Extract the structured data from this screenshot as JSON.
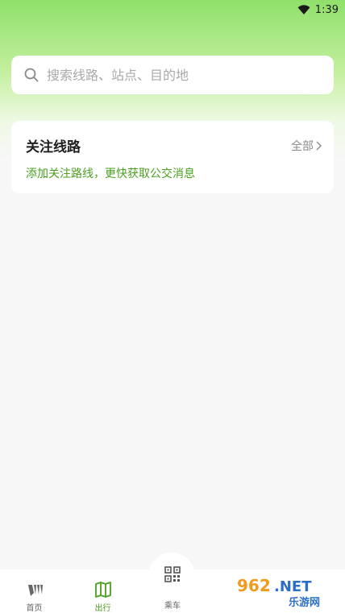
{
  "status": {
    "time": "1:39"
  },
  "search": {
    "placeholder": "搜索线路、站点、目的地"
  },
  "follow": {
    "title": "关注线路",
    "all_label": "全部",
    "desc": "添加关注路线，更快获取公交消息"
  },
  "nav": {
    "items": [
      {
        "label": "首页",
        "icon": "home-icon"
      },
      {
        "label": "出行",
        "icon": "map-icon",
        "active": true
      },
      {
        "label": "乘车",
        "icon": "qr-code-icon"
      }
    ]
  },
  "watermark": {
    "text": "962.NET",
    "subtext": "乐游网"
  },
  "colors": {
    "accent": "#4aa01f",
    "gradient_top": "#8fe06a"
  }
}
